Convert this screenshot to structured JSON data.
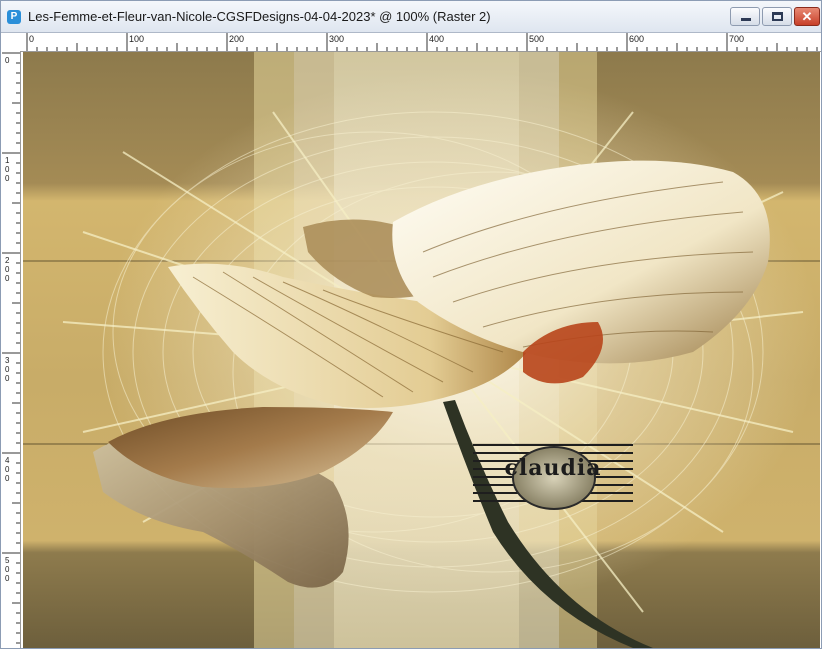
{
  "window": {
    "title": "Les-Femme-et-Fleur-van-Nicole-CGSFDesigns-04-04-2023* @ 100% (Raster 2)",
    "app_icon": "paintshop-icon",
    "controls": {
      "minimize_icon": "minimize-icon",
      "maximize_icon": "maximize-icon",
      "close_icon": "close-icon",
      "close_glyph": "✕"
    }
  },
  "rulers": {
    "top_labels": [
      "0",
      "100",
      "200",
      "300",
      "400",
      "500",
      "600",
      "700"
    ],
    "left_labels": [
      "0",
      "100",
      "200",
      "300",
      "400",
      "500"
    ],
    "unit": "pixels"
  },
  "canvas": {
    "layer": "Raster 2",
    "zoom": "100%",
    "watermark_text": "claudia",
    "colors": {
      "background_dark": "#8a7748",
      "background_mid": "#c9ad69",
      "highlight": "#f5efd9",
      "accent_orange": "#b8451b",
      "stem": "#2e3324"
    }
  }
}
